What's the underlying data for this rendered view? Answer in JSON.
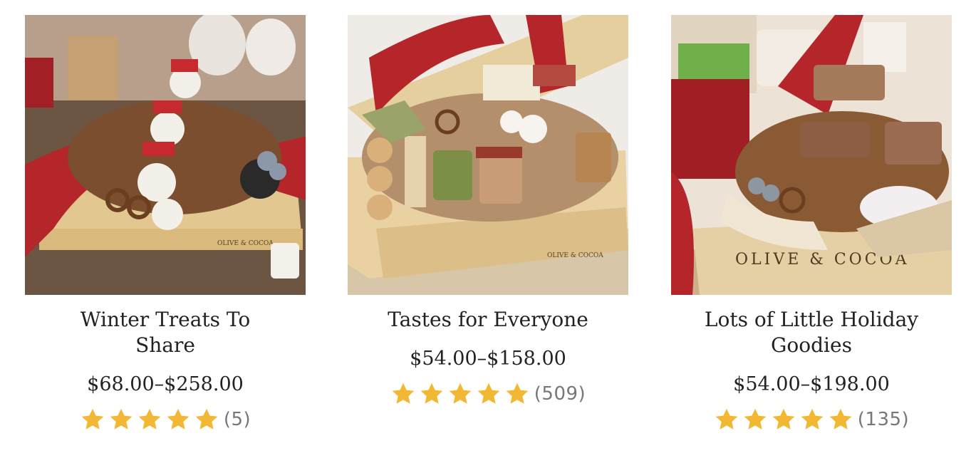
{
  "products": [
    {
      "title": "Winter Treats To Share",
      "price": "$68.00–$258.00",
      "rating": 5,
      "review_count": "(5)"
    },
    {
      "title": "Tastes for Everyone",
      "price": "$54.00–$158.00",
      "rating": 5,
      "review_count": "(509)"
    },
    {
      "title": "Lots of Little Holiday Goodies",
      "price": "$54.00–$198.00",
      "rating": 5,
      "review_count": "(135)"
    }
  ],
  "box_brand": "OLIVE & COCOA",
  "colors": {
    "star": "#F2B733",
    "ribbon": "#B5262A",
    "wood": "#E7CC97"
  }
}
